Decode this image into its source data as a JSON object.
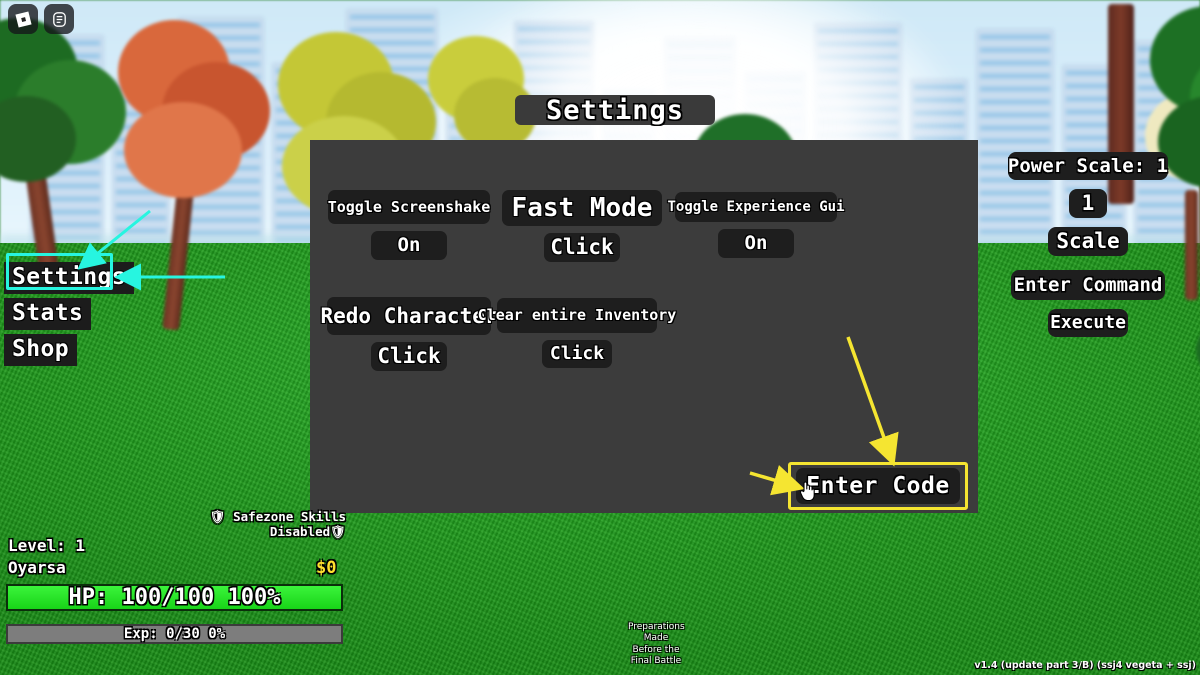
{
  "topbar": {
    "icons": [
      {
        "name": "roblox-logo-icon",
        "glyph": "roblox"
      },
      {
        "name": "chat-menu-icon",
        "glyph": "chat"
      }
    ]
  },
  "left_menu": {
    "items": [
      {
        "label": "Settings",
        "highlighted": true
      },
      {
        "label": "Stats",
        "highlighted": false
      },
      {
        "label": "Shop",
        "highlighted": false
      }
    ],
    "highlight_color": "#27f5e0"
  },
  "settings_panel": {
    "title": "Settings",
    "background_color": "#3c3c3c",
    "controls": [
      {
        "id": "toggle-screenshake",
        "label": "Toggle Screenshake",
        "value": "On"
      },
      {
        "id": "fast-mode",
        "label": "Fast Mode",
        "value": "Click"
      },
      {
        "id": "toggle-experience-gui",
        "label": "Toggle Experience Gui",
        "value": "On"
      },
      {
        "id": "redo-character",
        "label": "Redo Character",
        "value": "Click"
      },
      {
        "id": "clear-entire-inventory",
        "label": "Clear entire Inventory",
        "value": "Click"
      }
    ],
    "enter_code": {
      "label": "Enter Code",
      "highlight_color": "#f5e531"
    }
  },
  "right_panel": {
    "power_scale_label": "Power Scale: 1",
    "power_scale_value": "1",
    "scale_button": "Scale",
    "enter_command_label": "Enter Command",
    "execute_button": "Execute"
  },
  "hud": {
    "safezone_line1": "🛡 Safezone Skills",
    "safezone_line2": "Disabled🛡",
    "level": "Level: 1",
    "player_name": "Oyarsa",
    "money": "$0",
    "hp_text": "HP: 100/100 100%",
    "hp_percent": 100,
    "hp_color": "#29e029",
    "exp_text": "Exp: 0/30 0%",
    "exp_percent": 0,
    "objective": "Preparations Made Before the Final Battle"
  },
  "version": "v1.4 (update part 3/B) (ssj4 vegeta + ssj)"
}
